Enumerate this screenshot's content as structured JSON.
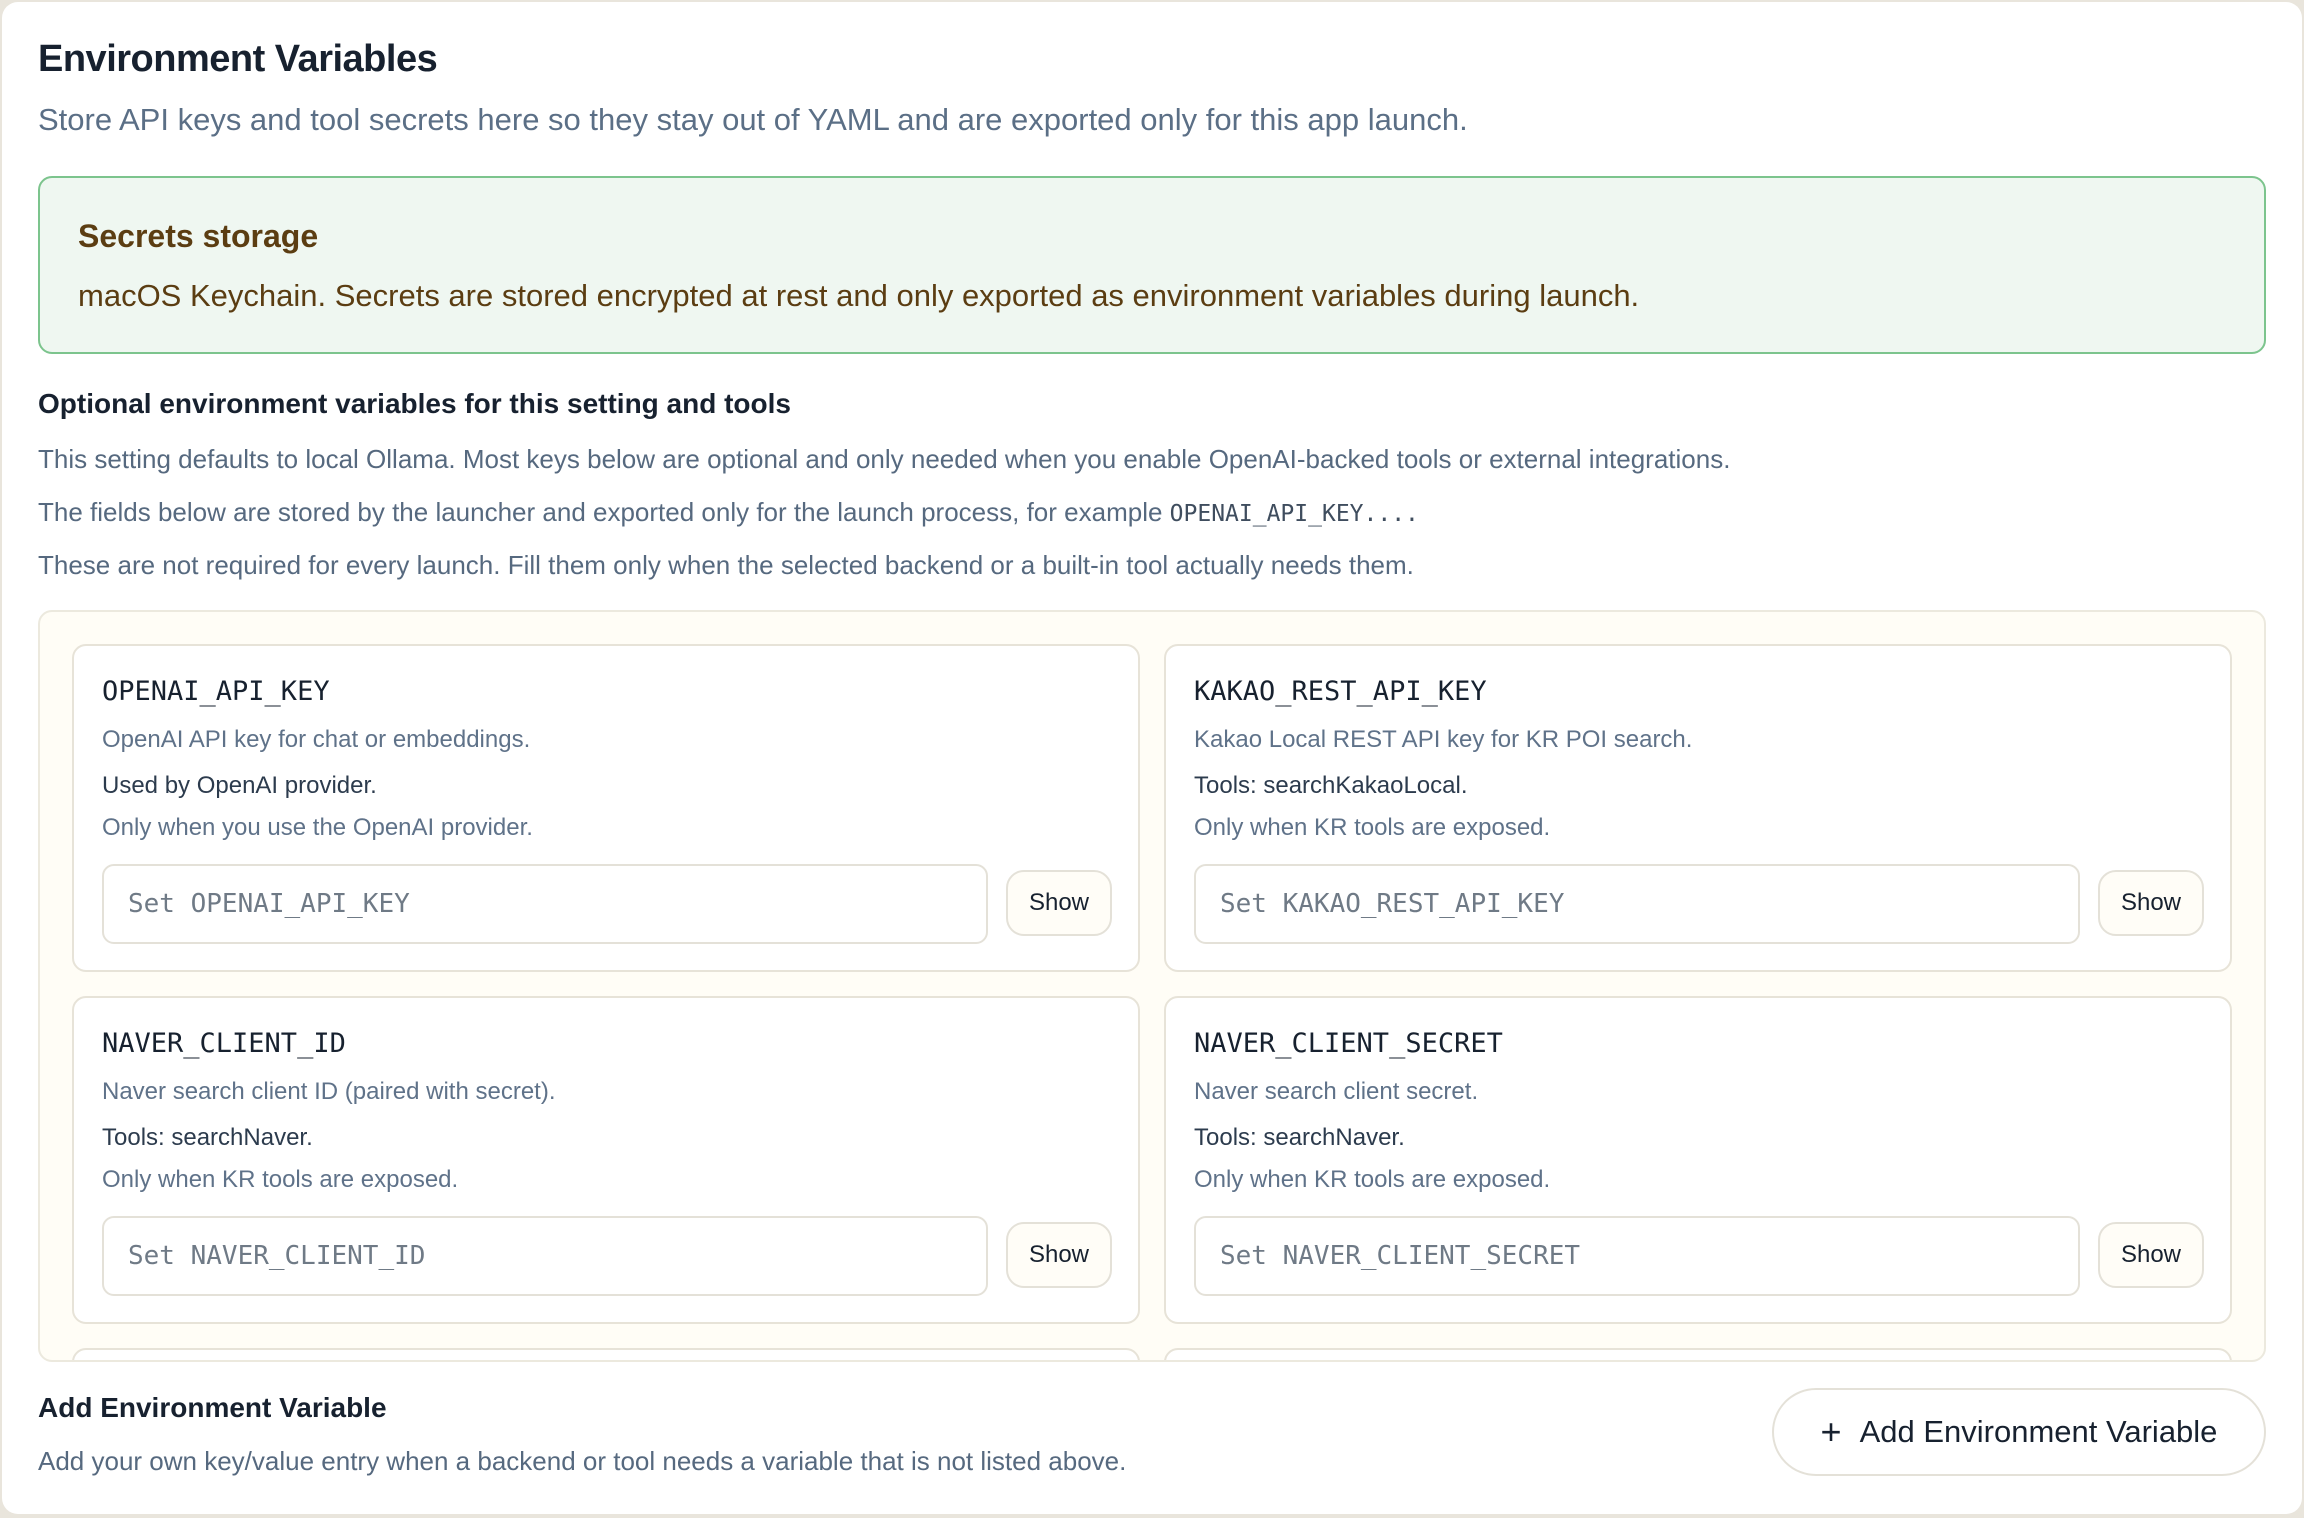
{
  "header": {
    "title": "Environment Variables",
    "subtitle": "Store API keys and tool secrets here so they stay out of YAML and are exported only for this app launch."
  },
  "storage": {
    "title": "Secrets storage",
    "text": "macOS Keychain. Secrets are stored encrypted at rest and only exported as environment variables during launch."
  },
  "optional": {
    "title": "Optional environment variables for this setting and tools",
    "line1": "This setting defaults to local Ollama. Most keys below are optional and only needed when you enable OpenAI-backed tools or external integrations.",
    "line2_prefix": "The fields below are stored by the launcher and exported only for the launch process, for example ",
    "line2_code": "OPENAI_API_KEY....",
    "line3": "These are not required for every launch. Fill them only when the selected backend or a built-in tool actually needs them."
  },
  "cards": [
    {
      "key": "OPENAI_API_KEY",
      "description": "OpenAI API key for chat or embeddings.",
      "used_by": "Used by OpenAI provider.",
      "when": "Only when you use the OpenAI provider.",
      "placeholder": "Set OPENAI_API_KEY",
      "show_label": "Show"
    },
    {
      "key": "KAKAO_REST_API_KEY",
      "description": "Kakao Local REST API key for KR POI search.",
      "used_by": "Tools: searchKakaoLocal.",
      "when": "Only when KR tools are exposed.",
      "placeholder": "Set KAKAO_REST_API_KEY",
      "show_label": "Show"
    },
    {
      "key": "NAVER_CLIENT_ID",
      "description": "Naver search client ID (paired with secret).",
      "used_by": "Tools: searchNaver.",
      "when": "Only when KR tools are exposed.",
      "placeholder": "Set NAVER_CLIENT_ID",
      "show_label": "Show"
    },
    {
      "key": "NAVER_CLIENT_SECRET",
      "description": "Naver search client secret.",
      "used_by": "Tools: searchNaver.",
      "when": "Only when KR tools are exposed.",
      "placeholder": "Set NAVER_CLIENT_SECRET",
      "show_label": "Show"
    }
  ],
  "add": {
    "title": "Add Environment Variable",
    "description": "Add your own key/value entry when a backend or tool needs a variable that is not listed above.",
    "button_label": "Add Environment Variable",
    "button_icon": "plus-icon"
  },
  "colors": {
    "storage_bg": "#eff7f1",
    "storage_border": "#7cc48d",
    "storage_text": "#5b3d12",
    "muted_text": "#56697f"
  }
}
